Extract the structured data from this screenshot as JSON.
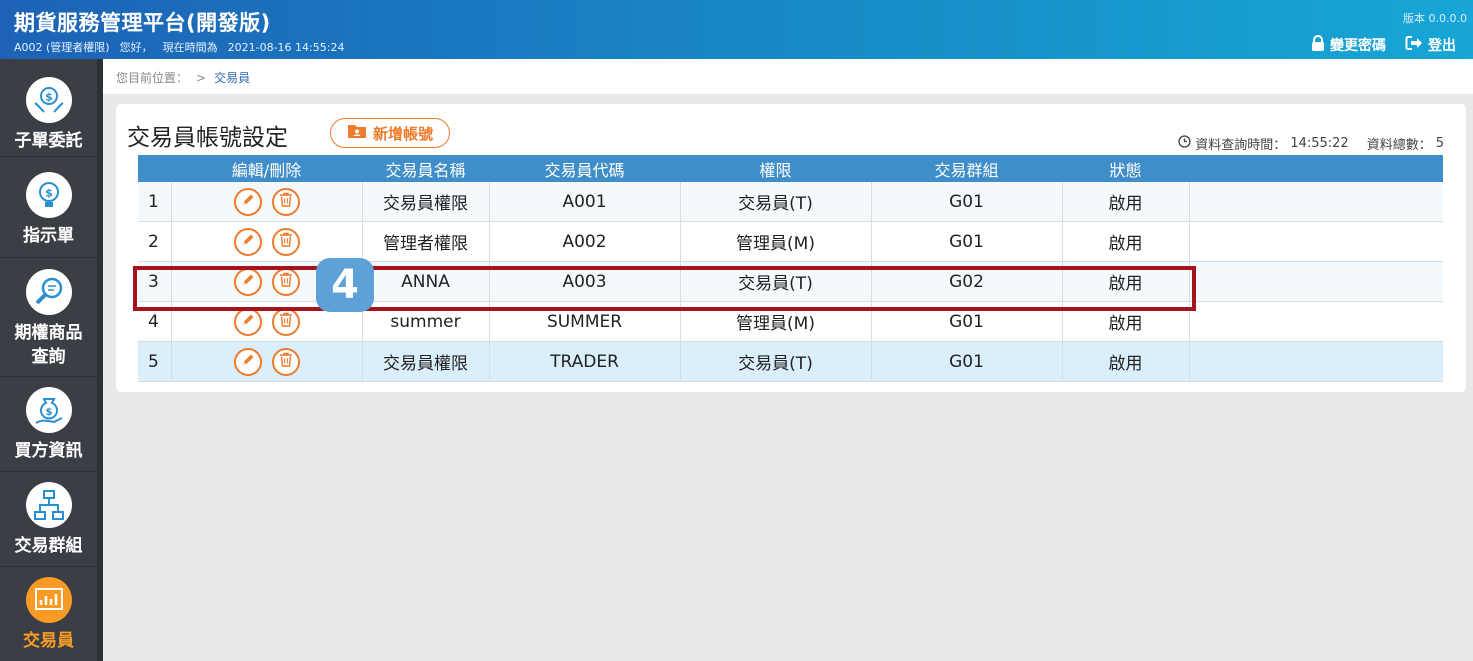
{
  "header": {
    "title": "期貨服務管理平台(開發版)",
    "user_id": "A002 (管理者權限)",
    "greeting": "您好，",
    "time_label": "現在時間為",
    "time_value": "2021-08-16 14:55:24",
    "version": "版本 0.0.0.0",
    "change_password": "變更密碼",
    "logout": "登出",
    "colors": {
      "header_start": "#1d62b6",
      "header_end": "#17a6d6"
    }
  },
  "sidebar": {
    "items": [
      {
        "label": "子單委託",
        "icon": "money-hands-icon"
      },
      {
        "label": "指示單",
        "icon": "lightbulb-dollar-icon"
      },
      {
        "label_line1": "期權商品",
        "label_line2": "查詢",
        "icon": "magnifier-icon"
      },
      {
        "label": "買方資訊",
        "icon": "money-bag-hand-icon"
      },
      {
        "label": "交易群組",
        "icon": "org-chart-icon"
      },
      {
        "label": "交易員",
        "icon": "monitor-chart-icon",
        "active": true
      }
    ],
    "active_color": "#f79b25"
  },
  "breadcrumb": {
    "prefix": "您目前位置：",
    "sep": ">",
    "current": "交易員"
  },
  "panel": {
    "title": "交易員帳號設定",
    "add_button": "新增帳號",
    "query_time_label": "資料查詢時間：",
    "query_time": "14:55:22",
    "total_label": "資料總數：",
    "total": "5"
  },
  "table": {
    "headers": [
      "",
      "編輯/刪除",
      "交易員名稱",
      "交易員代碼",
      "權限",
      "交易群組",
      "狀態",
      ""
    ],
    "rows": [
      {
        "no": "1",
        "name": "交易員權限",
        "code": "A001",
        "role": "交易員(T)",
        "group": "G01",
        "status": "啟用"
      },
      {
        "no": "2",
        "name": "管理者權限",
        "code": "A002",
        "role": "管理員(M)",
        "group": "G01",
        "status": "啟用"
      },
      {
        "no": "3",
        "name": "ANNA",
        "code": "A003",
        "role": "交易員(T)",
        "group": "G02",
        "status": "啟用"
      },
      {
        "no": "4",
        "name": "summer",
        "code": "SUMMER",
        "role": "管理員(M)",
        "group": "G01",
        "status": "啟用"
      },
      {
        "no": "5",
        "name": "交易員權限",
        "code": "TRADER",
        "role": "交易員(T)",
        "group": "G01",
        "status": "啟用"
      }
    ]
  },
  "annotation": {
    "step": "4",
    "highlight_color": "#a5141c",
    "badge_color": "#5ea0d8"
  }
}
